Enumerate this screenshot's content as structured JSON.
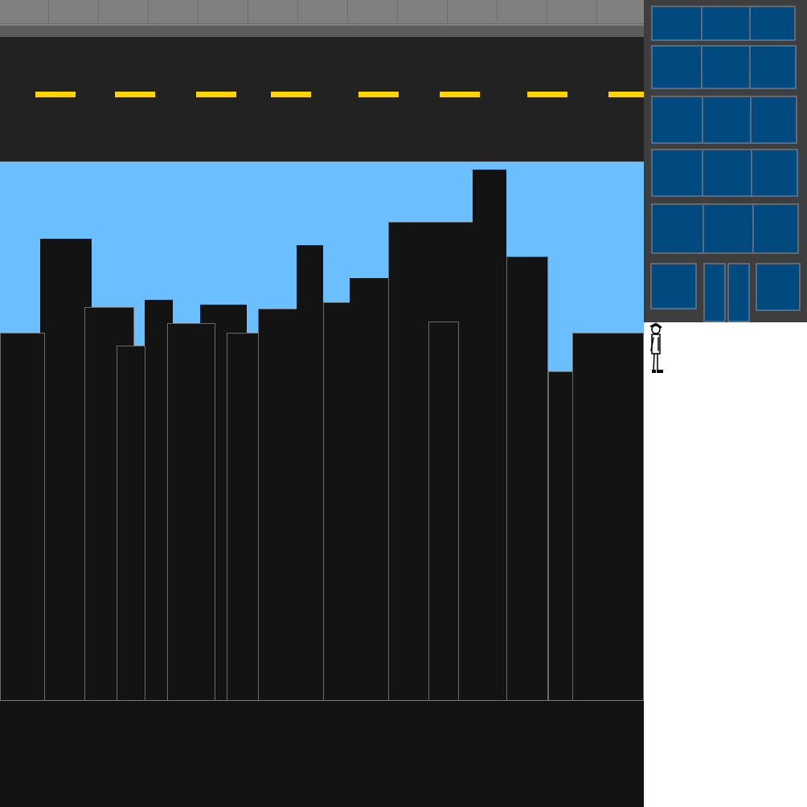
{
  "scene": {
    "colors": {
      "sky": "#6cbfff",
      "road": "#222222",
      "lane_marking": "#ffd400",
      "building": "#131313",
      "building_outline": "#6a6a6a",
      "sidewalk": "#808080",
      "window": "#004a80",
      "tower": "#3e3e3e"
    },
    "elements": {
      "player": "stick-figure-character",
      "background": "city-skyline",
      "structure": "office-building-with-windows"
    }
  }
}
